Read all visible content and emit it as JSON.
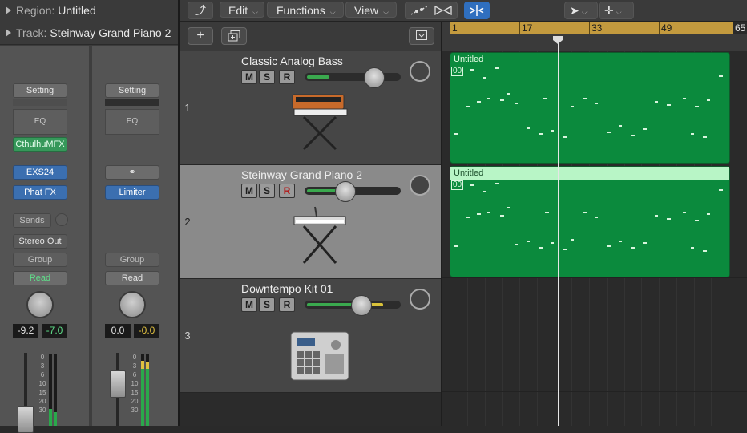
{
  "inspector": {
    "region_label": "Region:",
    "region_value": "Untitled",
    "track_label": "Track:",
    "track_value": "Steinway Grand Piano 2",
    "strip1": {
      "setting": "Setting",
      "eq": "EQ",
      "midi_fx": "CthulhuMFX",
      "instrument": "EXS24",
      "effect": "Phat FX",
      "sends": "Sends",
      "output": "Stereo Out",
      "group": "Group",
      "automation": "Read",
      "volume": "-9.2",
      "peak": "-7.0"
    },
    "strip2": {
      "setting": "Setting",
      "eq": "EQ",
      "effect": "Limiter",
      "group": "Group",
      "automation": "Read",
      "volume": "0.0",
      "peak": "-0.0"
    },
    "fader_scale": [
      "0",
      "3",
      "6",
      "10",
      "15",
      "20",
      "30"
    ]
  },
  "toolbar": {
    "edit": "Edit",
    "functions": "Functions",
    "view": "View"
  },
  "ruler": {
    "marks": [
      "1",
      "17",
      "33",
      "49",
      "65"
    ],
    "color": "#c39a3e"
  },
  "tracks": [
    {
      "number": "1",
      "name": "Classic Analog Bass",
      "mute": "M",
      "solo": "S",
      "record": "R",
      "volume_fraction": 0.69,
      "selected": false
    },
    {
      "number": "2",
      "name": "Steinway Grand Piano 2",
      "mute": "M",
      "solo": "S",
      "record": "R",
      "volume_fraction": 0.38,
      "selected": true
    },
    {
      "number": "3",
      "name": "Downtempo Kit 01",
      "mute": "M",
      "solo": "S",
      "record": "R",
      "volume_fraction": 0.59,
      "selected": false
    }
  ],
  "regions": [
    {
      "name": "Untitled",
      "marker": "00"
    },
    {
      "name": "Untitled",
      "marker": "00"
    }
  ],
  "icons": {
    "back": "back-arrow-icon",
    "automation": "automation-curve-icon",
    "flex": "flex-icon",
    "catch": "catch-playhead-icon",
    "pointer": "pointer-tool-icon",
    "crosshair": "marquee-tool-icon",
    "add": "add-track-icon",
    "duplicate": "duplicate-track-icon",
    "collapse": "collapse-icon"
  },
  "colors": {
    "region_green": "#0b8a3d",
    "selected_region_header": "#b8f5c6",
    "send_blue": "#3b6fb0",
    "midi_green": "#36985a"
  }
}
